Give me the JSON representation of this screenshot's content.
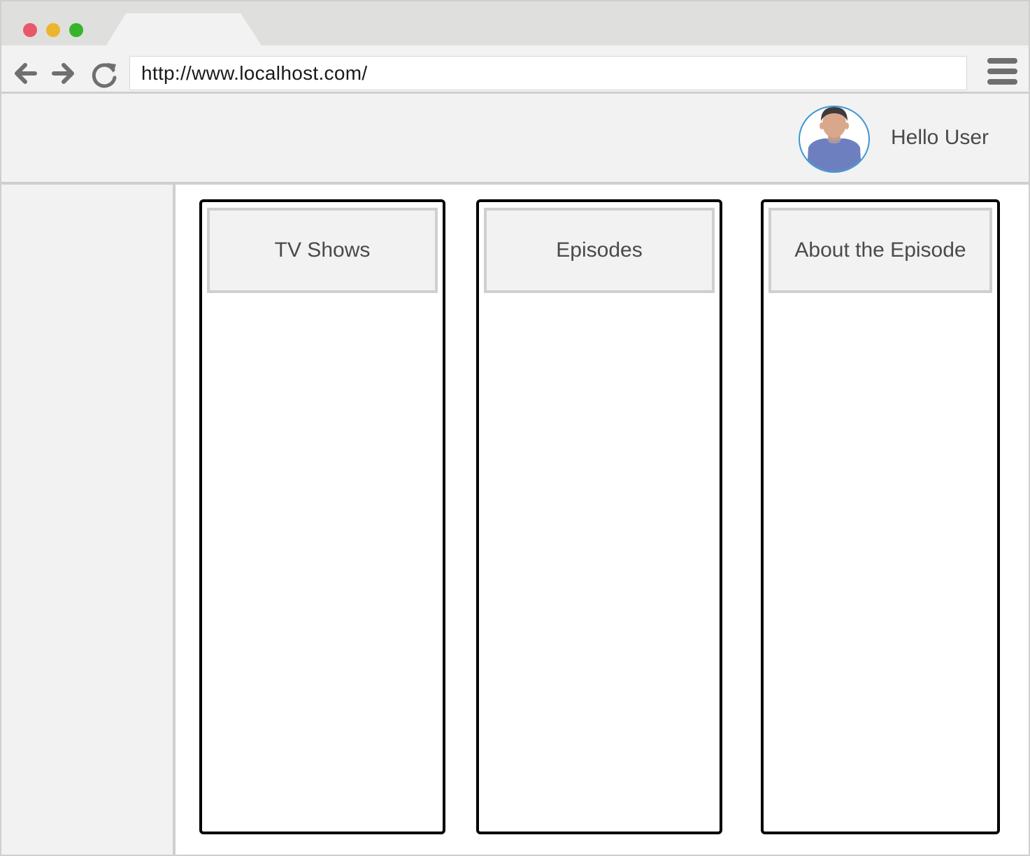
{
  "browser": {
    "url": "http://www.localhost.com/",
    "window_controls": [
      "close",
      "minimize",
      "maximize"
    ],
    "nav_icons": [
      "arrow-left-icon",
      "arrow-right-icon",
      "reload-icon",
      "hamburger-menu-icon"
    ]
  },
  "header": {
    "greeting": "Hello User",
    "avatar_icon": "user-avatar-icon"
  },
  "columns": [
    {
      "title": "TV Shows"
    },
    {
      "title": "Episodes"
    },
    {
      "title": "About the Episode"
    }
  ],
  "colors": {
    "close": "#e9586a",
    "minimize": "#ecb52f",
    "maximize": "#36b52c",
    "avatar_ring": "#3d96d3"
  }
}
